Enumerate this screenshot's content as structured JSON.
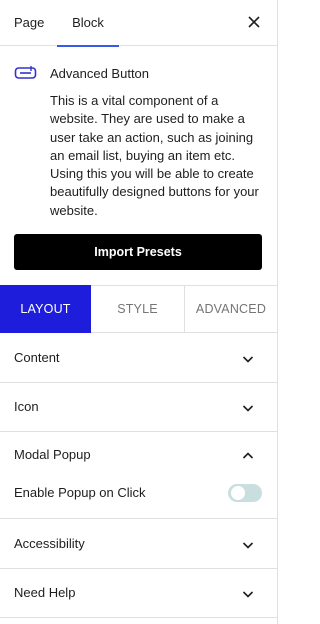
{
  "tabs": {
    "page": "Page",
    "block": "Block"
  },
  "block": {
    "icon": "advanced-button-icon",
    "title": "Advanced Button",
    "description": "This is a vital component of a website. They are used to make a user take an action, such as joining an email list, buying an item etc. Using this you will be able to create beautifully designed buttons for your website."
  },
  "import_presets_label": "Import Presets",
  "settings_tabs": {
    "layout": "LAYOUT",
    "style": "STYLE",
    "advanced": "ADVANCED"
  },
  "panels": {
    "content": "Content",
    "icon": "Icon",
    "modal_popup": "Modal Popup",
    "enable_popup_label": "Enable Popup on Click",
    "enable_popup_on": false,
    "accessibility": "Accessibility",
    "need_help": "Need Help"
  },
  "colors": {
    "accent_tab": "#1d1ddb",
    "tab_underline": "#3858e9",
    "import_button": "#000000",
    "toggle_off": "#c9dede",
    "block_icon": "#3333cc"
  }
}
